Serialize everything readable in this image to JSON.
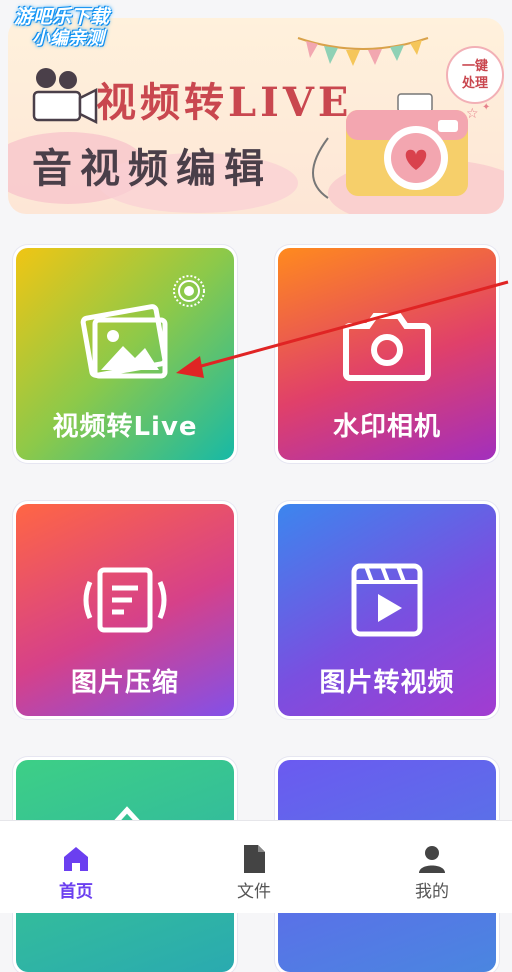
{
  "watermark": {
    "line1": "游吧乐下载",
    "line2": "小编亲测"
  },
  "banner": {
    "title1": "视频转LIVE",
    "title2": "音视频编辑",
    "badge_line1": "一键",
    "badge_line2": "处理"
  },
  "cards": [
    {
      "label": "视频转Live",
      "icon": "photos-icon"
    },
    {
      "label": "水印相机",
      "icon": "camera-icon"
    },
    {
      "label": "图片压缩",
      "icon": "compress-icon"
    },
    {
      "label": "图片转视频",
      "icon": "video-clapper-icon"
    }
  ],
  "nav": {
    "items": [
      {
        "label": "首页",
        "icon": "home-icon",
        "active": true
      },
      {
        "label": "文件",
        "icon": "file-icon",
        "active": false
      },
      {
        "label": "我的",
        "icon": "user-icon",
        "active": false
      }
    ]
  },
  "colors": {
    "accent": "#6b3ff0",
    "arrow": "#e02424"
  }
}
